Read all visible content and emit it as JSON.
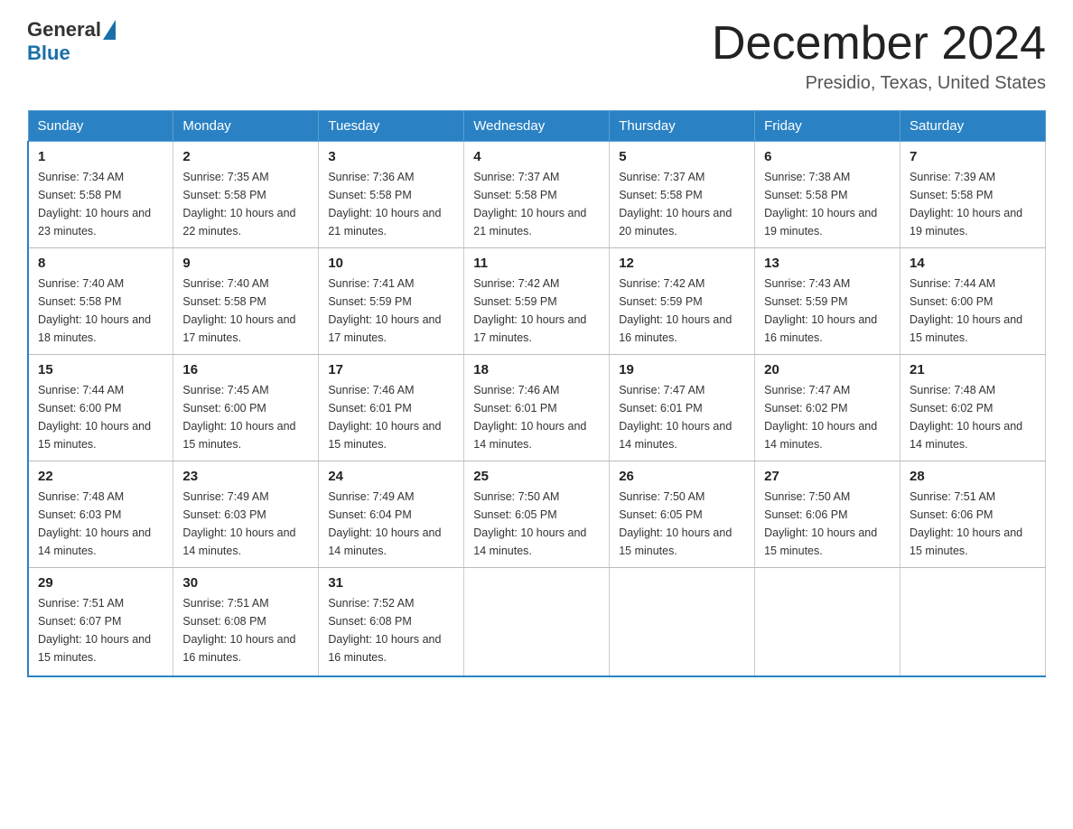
{
  "header": {
    "logo_text_general": "General",
    "logo_text_blue": "Blue",
    "month_title": "December 2024",
    "location": "Presidio, Texas, United States"
  },
  "weekdays": [
    "Sunday",
    "Monday",
    "Tuesday",
    "Wednesday",
    "Thursday",
    "Friday",
    "Saturday"
  ],
  "weeks": [
    [
      {
        "day": "1",
        "sunrise": "7:34 AM",
        "sunset": "5:58 PM",
        "daylight": "10 hours and 23 minutes."
      },
      {
        "day": "2",
        "sunrise": "7:35 AM",
        "sunset": "5:58 PM",
        "daylight": "10 hours and 22 minutes."
      },
      {
        "day": "3",
        "sunrise": "7:36 AM",
        "sunset": "5:58 PM",
        "daylight": "10 hours and 21 minutes."
      },
      {
        "day": "4",
        "sunrise": "7:37 AM",
        "sunset": "5:58 PM",
        "daylight": "10 hours and 21 minutes."
      },
      {
        "day": "5",
        "sunrise": "7:37 AM",
        "sunset": "5:58 PM",
        "daylight": "10 hours and 20 minutes."
      },
      {
        "day": "6",
        "sunrise": "7:38 AM",
        "sunset": "5:58 PM",
        "daylight": "10 hours and 19 minutes."
      },
      {
        "day": "7",
        "sunrise": "7:39 AM",
        "sunset": "5:58 PM",
        "daylight": "10 hours and 19 minutes."
      }
    ],
    [
      {
        "day": "8",
        "sunrise": "7:40 AM",
        "sunset": "5:58 PM",
        "daylight": "10 hours and 18 minutes."
      },
      {
        "day": "9",
        "sunrise": "7:40 AM",
        "sunset": "5:58 PM",
        "daylight": "10 hours and 17 minutes."
      },
      {
        "day": "10",
        "sunrise": "7:41 AM",
        "sunset": "5:59 PM",
        "daylight": "10 hours and 17 minutes."
      },
      {
        "day": "11",
        "sunrise": "7:42 AM",
        "sunset": "5:59 PM",
        "daylight": "10 hours and 17 minutes."
      },
      {
        "day": "12",
        "sunrise": "7:42 AM",
        "sunset": "5:59 PM",
        "daylight": "10 hours and 16 minutes."
      },
      {
        "day": "13",
        "sunrise": "7:43 AM",
        "sunset": "5:59 PM",
        "daylight": "10 hours and 16 minutes."
      },
      {
        "day": "14",
        "sunrise": "7:44 AM",
        "sunset": "6:00 PM",
        "daylight": "10 hours and 15 minutes."
      }
    ],
    [
      {
        "day": "15",
        "sunrise": "7:44 AM",
        "sunset": "6:00 PM",
        "daylight": "10 hours and 15 minutes."
      },
      {
        "day": "16",
        "sunrise": "7:45 AM",
        "sunset": "6:00 PM",
        "daylight": "10 hours and 15 minutes."
      },
      {
        "day": "17",
        "sunrise": "7:46 AM",
        "sunset": "6:01 PM",
        "daylight": "10 hours and 15 minutes."
      },
      {
        "day": "18",
        "sunrise": "7:46 AM",
        "sunset": "6:01 PM",
        "daylight": "10 hours and 14 minutes."
      },
      {
        "day": "19",
        "sunrise": "7:47 AM",
        "sunset": "6:01 PM",
        "daylight": "10 hours and 14 minutes."
      },
      {
        "day": "20",
        "sunrise": "7:47 AM",
        "sunset": "6:02 PM",
        "daylight": "10 hours and 14 minutes."
      },
      {
        "day": "21",
        "sunrise": "7:48 AM",
        "sunset": "6:02 PM",
        "daylight": "10 hours and 14 minutes."
      }
    ],
    [
      {
        "day": "22",
        "sunrise": "7:48 AM",
        "sunset": "6:03 PM",
        "daylight": "10 hours and 14 minutes."
      },
      {
        "day": "23",
        "sunrise": "7:49 AM",
        "sunset": "6:03 PM",
        "daylight": "10 hours and 14 minutes."
      },
      {
        "day": "24",
        "sunrise": "7:49 AM",
        "sunset": "6:04 PM",
        "daylight": "10 hours and 14 minutes."
      },
      {
        "day": "25",
        "sunrise": "7:50 AM",
        "sunset": "6:05 PM",
        "daylight": "10 hours and 14 minutes."
      },
      {
        "day": "26",
        "sunrise": "7:50 AM",
        "sunset": "6:05 PM",
        "daylight": "10 hours and 15 minutes."
      },
      {
        "day": "27",
        "sunrise": "7:50 AM",
        "sunset": "6:06 PM",
        "daylight": "10 hours and 15 minutes."
      },
      {
        "day": "28",
        "sunrise": "7:51 AM",
        "sunset": "6:06 PM",
        "daylight": "10 hours and 15 minutes."
      }
    ],
    [
      {
        "day": "29",
        "sunrise": "7:51 AM",
        "sunset": "6:07 PM",
        "daylight": "10 hours and 15 minutes."
      },
      {
        "day": "30",
        "sunrise": "7:51 AM",
        "sunset": "6:08 PM",
        "daylight": "10 hours and 16 minutes."
      },
      {
        "day": "31",
        "sunrise": "7:52 AM",
        "sunset": "6:08 PM",
        "daylight": "10 hours and 16 minutes."
      },
      null,
      null,
      null,
      null
    ]
  ]
}
